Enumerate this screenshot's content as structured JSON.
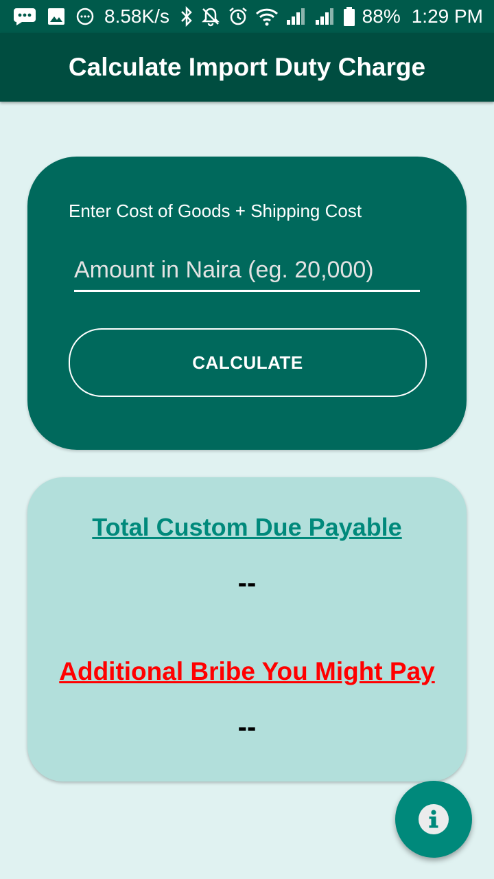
{
  "status_bar": {
    "speed": "8.58K/s",
    "battery": "88%",
    "time": "1:29 PM",
    "icons": [
      "message-icon",
      "image-icon",
      "chat-bubble-icon",
      "bluetooth-icon",
      "notifications-off-icon",
      "alarm-icon",
      "wifi-icon",
      "signal-icon",
      "signal-icon",
      "battery-icon"
    ]
  },
  "app_bar": {
    "title": "Calculate Import Duty Charge"
  },
  "input_card": {
    "label": "Enter Cost of Goods + Shipping Cost",
    "amount_placeholder": "Amount in Naira (eg. 20,000)",
    "calculate_label": "CALCULATE"
  },
  "result_card": {
    "total_title": "Total Custom Due Payable",
    "total_value": "--",
    "bribe_title": "Additional Bribe You Might Pay",
    "bribe_value": "--"
  },
  "fab": {
    "icon": "info-icon"
  },
  "colors": {
    "status_bar": "#005a4b",
    "app_bar": "#004d40",
    "background": "#e0f2f1",
    "input_card": "#00695c",
    "result_card": "#b2dfdb",
    "total_title": "#00897b",
    "bribe_title": "#ff0000",
    "fab": "#00897b"
  }
}
